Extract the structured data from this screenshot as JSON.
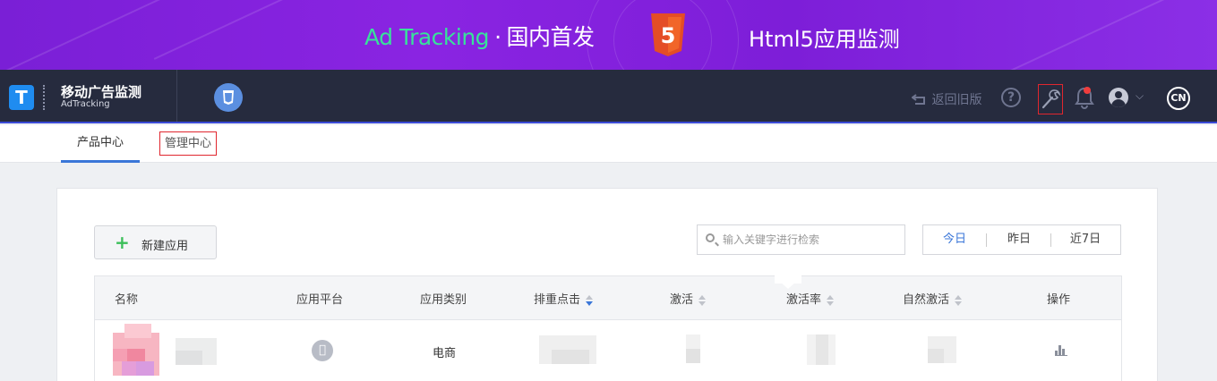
{
  "banner": {
    "accent_text": "Ad Tracking",
    "separator": "·",
    "tagline": "国内首发",
    "right_text": "Html5应用监测",
    "badge_glyph": "5"
  },
  "navbar": {
    "logo_letter": "T",
    "brand_title": "移动广告监测",
    "brand_subtitle": "AdTracking",
    "back_label": "返回旧版",
    "help_glyph": "?",
    "lang_badge": "CN",
    "icons": [
      "h5-icon",
      "undo-icon",
      "help-icon",
      "wrench-icon",
      "bell-icon",
      "avatar-icon",
      "chevron-down-icon"
    ]
  },
  "subnav": {
    "tabs": [
      {
        "label": "产品中心",
        "active": true
      },
      {
        "label": "管理中心",
        "active": false
      }
    ]
  },
  "toolbar": {
    "new_button_label": "新建应用",
    "search_placeholder": "输入关键字进行检索",
    "date_options": [
      {
        "label": "今日",
        "active": true
      },
      {
        "label": "昨日",
        "active": false
      },
      {
        "label": "近7日",
        "active": false
      }
    ]
  },
  "table": {
    "columns": [
      {
        "label": "名称",
        "sortable": false
      },
      {
        "label": "应用平台",
        "sortable": false
      },
      {
        "label": "应用类别",
        "sortable": false
      },
      {
        "label": "排重点击",
        "sortable": true,
        "sorted": true
      },
      {
        "label": "激活",
        "sortable": true
      },
      {
        "label": "激活率",
        "sortable": true
      },
      {
        "label": "自然激活",
        "sortable": true
      },
      {
        "label": "操作",
        "sortable": false
      }
    ],
    "rows": [
      {
        "platform": "apple",
        "category": "电商",
        "action_icon": "bar-chart-icon"
      }
    ]
  },
  "colors": {
    "banner": "#7a1fd6",
    "navbar": "#262b3e",
    "accent_blue": "#3a76d8",
    "highlight_red": "#e0262e",
    "plus_green": "#3cbf5a",
    "banner_green": "#38e29a",
    "h5_orange": "#e44d26"
  }
}
